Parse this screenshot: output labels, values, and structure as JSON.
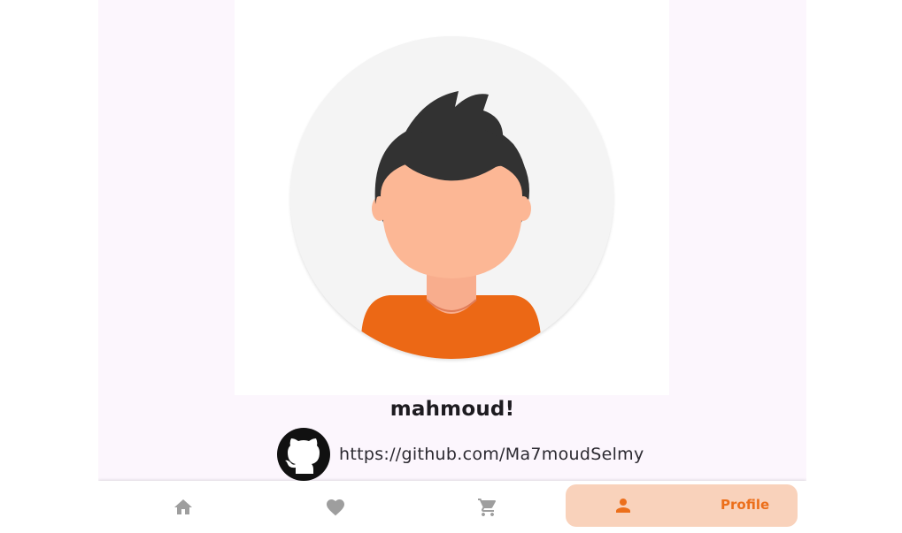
{
  "profile": {
    "name": "mahmoud!",
    "github_url": "https://github.com/Ma7moudSelmy"
  },
  "nav": {
    "items": [
      {
        "icon": "home-icon",
        "label": "Home"
      },
      {
        "icon": "heart-icon",
        "label": "Favorites"
      },
      {
        "icon": "cart-icon",
        "label": "Cart"
      },
      {
        "icon": "person-icon",
        "label": "Profile",
        "active": true
      }
    ],
    "active_label": "Profile"
  },
  "colors": {
    "accent": "#ec6f1b",
    "active_pill": "#f9d2bb",
    "inactive_icon": "#9e9e9e",
    "background": "#fcf6fd"
  }
}
